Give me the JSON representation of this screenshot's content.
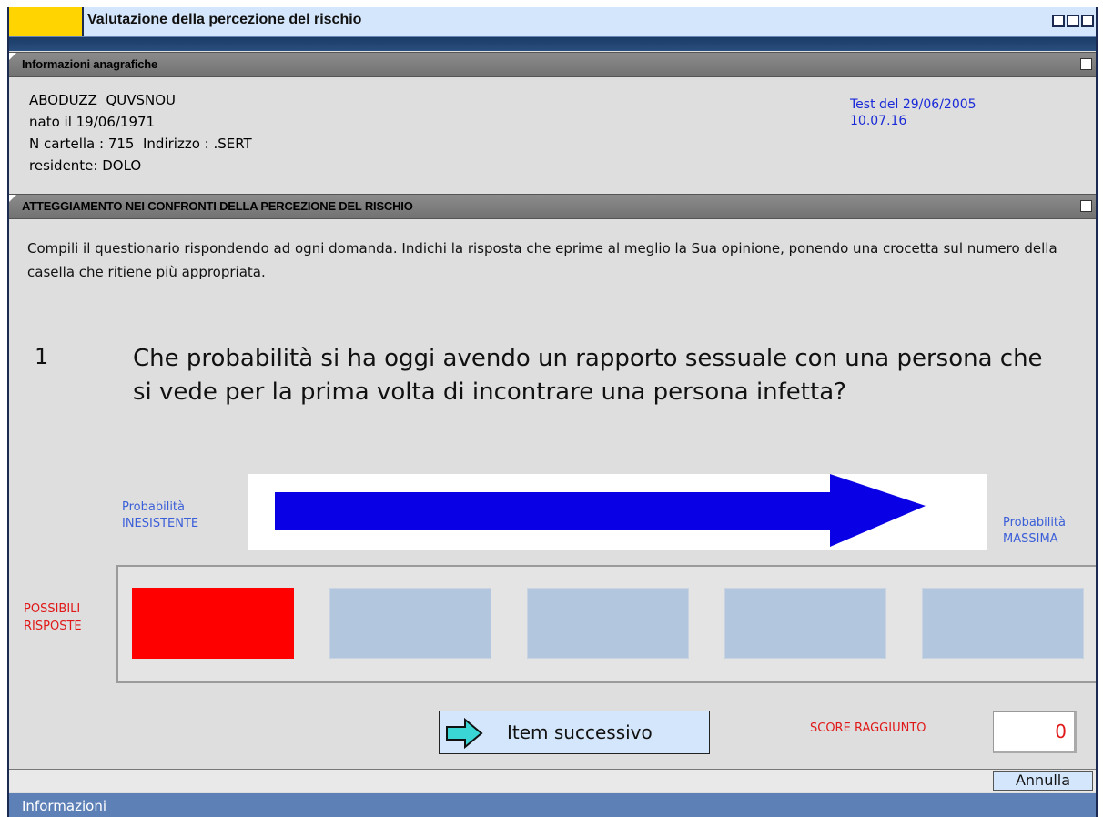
{
  "window": {
    "title": "Valutazione della percezione del rischio"
  },
  "anagrafica": {
    "header": "Informazioni anagrafiche",
    "name": "ABODUZZ  QUVSNOU",
    "born": "nato il 19/06/1971",
    "cartella": "N cartella : 715  Indirizzo : .SERT",
    "residence": "residente: DOLO",
    "test_date": "Test del 29/06/2005",
    "test_time": "10.07.16"
  },
  "questionario": {
    "header": "ATTEGGIAMENTO NEI CONFRONTI DELLA PERCEZIONE DEL RISCHIO",
    "instructions": "Compili il questionario rispondendo ad ogni domanda. Indichi la risposta che eprime al meglio la Sua opinione, ponendo una crocetta sul numero della casella che ritiene più appropriata.",
    "question_number": "1",
    "question_text": "Che probabilità si ha oggi avendo un rapporto sessuale con una persona che si vede per la prima volta di incontrare una persona infetta?",
    "scale_left_1": "Probabilità",
    "scale_left_2": "INESISTENTE",
    "scale_right_1": "Probabilità",
    "scale_right_2": "MASSIMA",
    "answers_label_1": "POSSIBILI",
    "answers_label_2": "RISPOSTE",
    "answer_count": 5,
    "selected_answer": 1,
    "next_button": "Item successivo",
    "score_label": "SCORE RAGGIUNTO",
    "score_value": "0"
  },
  "footer": {
    "cancel_button": "Annulla",
    "status": "Informazioni"
  },
  "colors": {
    "selected": "#ff0000",
    "unselected": "#b2c6dd",
    "arrow": "#0a00e6",
    "accent": "#ffd400"
  }
}
